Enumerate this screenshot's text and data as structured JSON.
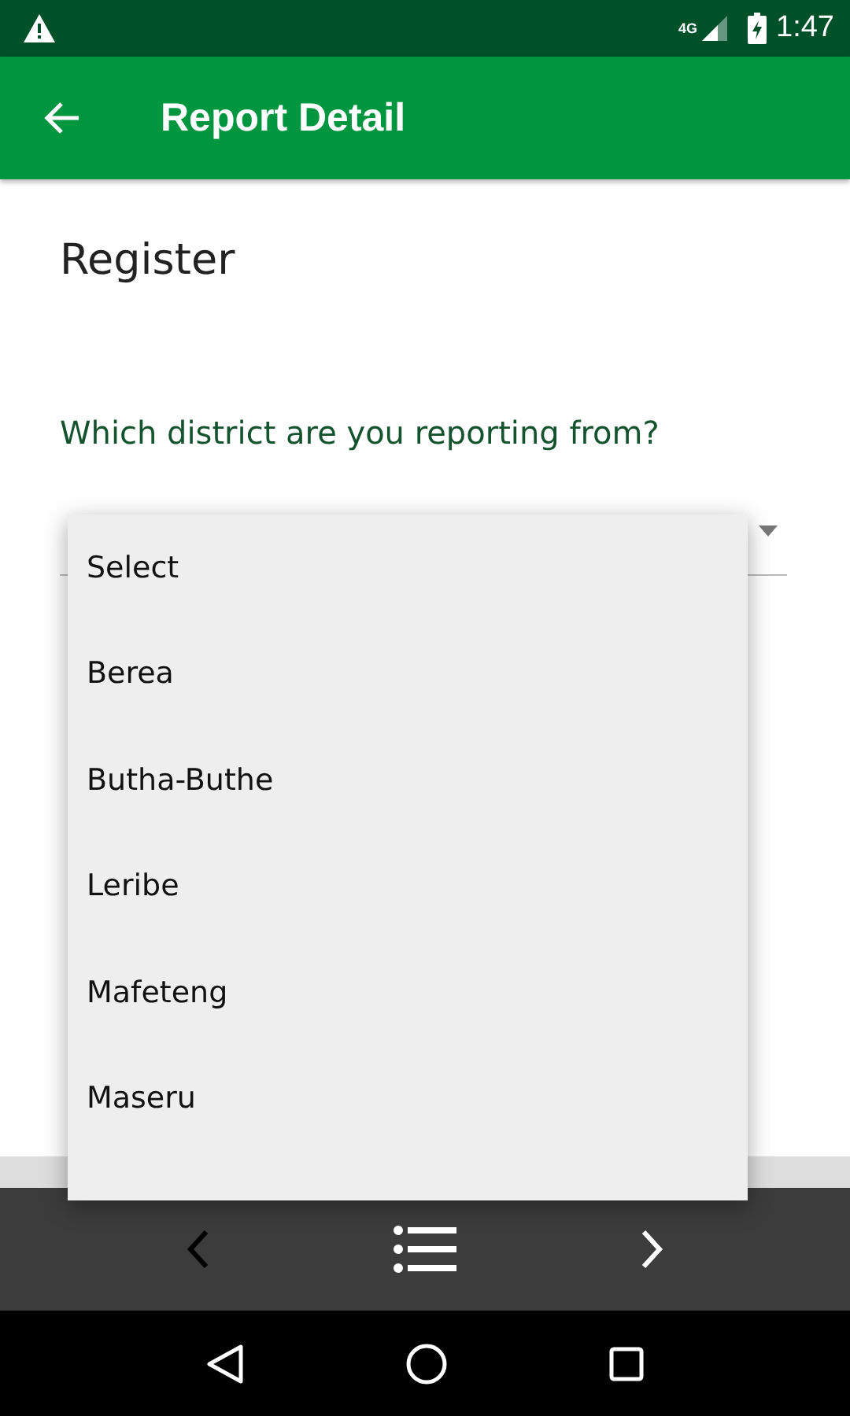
{
  "status_bar": {
    "network": "4G",
    "time": "1:47"
  },
  "app_bar": {
    "title": "Report Detail"
  },
  "section_title": "Register",
  "question": "Which district are you reporting from?",
  "dropdown": {
    "expanded": true,
    "options": [
      {
        "label": "Select"
      },
      {
        "label": "Berea"
      },
      {
        "label": "Butha-Buthe"
      },
      {
        "label": "Leribe"
      },
      {
        "label": "Mafeteng"
      },
      {
        "label": "Maseru"
      }
    ]
  }
}
